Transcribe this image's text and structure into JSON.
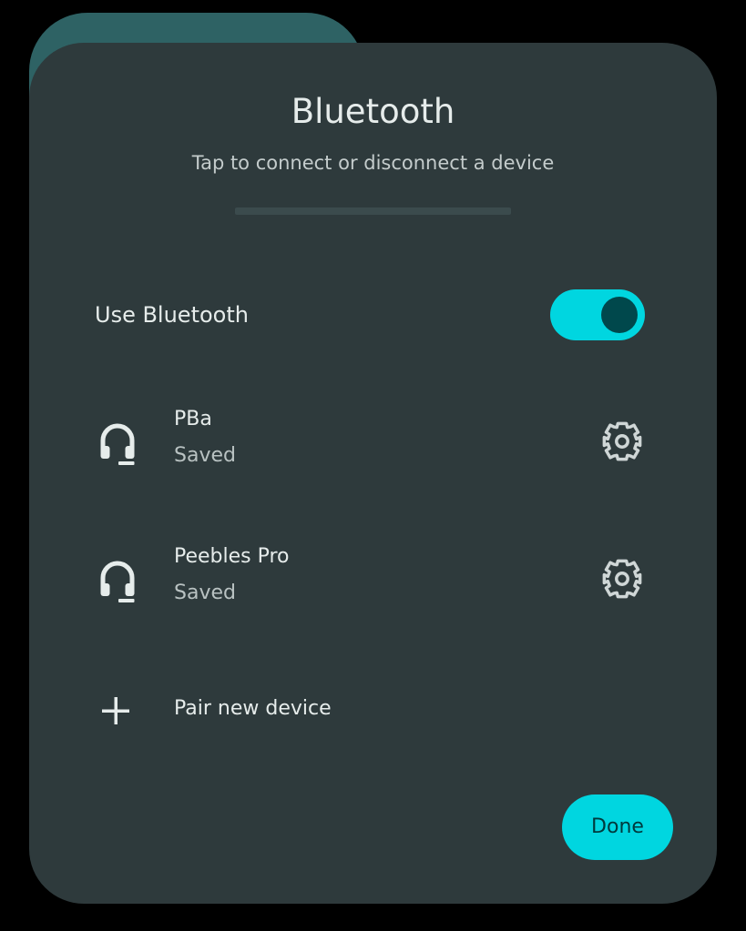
{
  "dialog": {
    "title": "Bluetooth",
    "subtitle": "Tap to connect or disconnect a device"
  },
  "toggle": {
    "label": "Use Bluetooth",
    "state": "on"
  },
  "devices": [
    {
      "name": "PBa",
      "status": "Saved",
      "icon": "headset-icon",
      "action_icon": "gear-icon"
    },
    {
      "name": "Peebles Pro",
      "status": "Saved",
      "icon": "headset-icon",
      "action_icon": "gear-icon"
    }
  ],
  "pair": {
    "label": "Pair new device",
    "icon": "plus-icon"
  },
  "actions": {
    "done_label": "Done"
  },
  "colors": {
    "background": "#000000",
    "dialog": "#2e3a3c",
    "accent": "#00d6e0",
    "text": "#e6eceb"
  }
}
